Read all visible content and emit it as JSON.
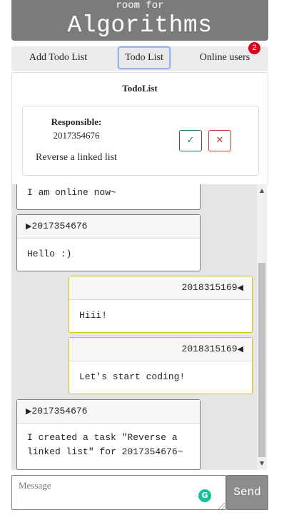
{
  "header": {
    "subtitle": "room for",
    "title": "Algorithms"
  },
  "tabs": [
    {
      "label": "Add Todo List"
    },
    {
      "label": "Todo List",
      "active": true
    },
    {
      "label": "Online users"
    }
  ],
  "online_badge": "2",
  "todo": {
    "heading": "TodoList",
    "responsible_label": "Responsible:",
    "responsible_value": "2017354676",
    "task": "Reverse a linked list",
    "accept_icon": "check-icon",
    "accept_symbol": "✓",
    "reject_icon": "close-icon",
    "reject_symbol": "✕"
  },
  "messages": [
    {
      "author": "",
      "text": "I am online now~",
      "mine": false
    },
    {
      "author": "2017354676",
      "text": "Hello :)",
      "mine": false
    },
    {
      "author": "2018315169",
      "text": "Hiii!",
      "mine": true
    },
    {
      "author": "2018315169",
      "text": "Let's start coding!",
      "mine": true
    },
    {
      "author": "2017354676",
      "text": "I created a task \"Reverse a linked list\" for 2017354676~",
      "mine": false
    }
  ],
  "composer": {
    "placeholder": "Message",
    "send_label": "Send"
  },
  "colors": {
    "header_bg": "#7b7b7b",
    "chat_bg": "#e5e5e5",
    "accept": "#1d7a4f",
    "reject": "#c0392b",
    "own_message_border": "#e0c300",
    "badge": "#e00020"
  }
}
